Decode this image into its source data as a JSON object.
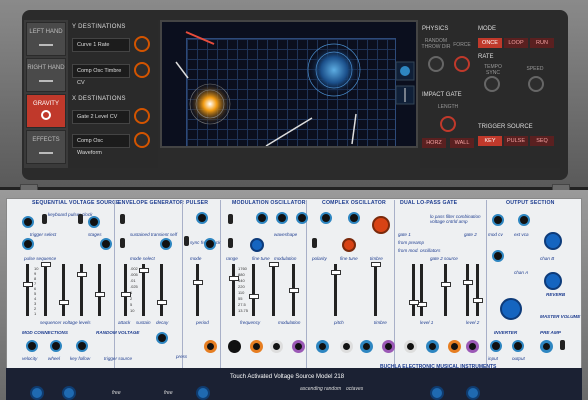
{
  "top": {
    "modes": [
      {
        "label": "LEFT HAND",
        "icon": "hand-icon"
      },
      {
        "label": "RIGHT HAND",
        "icon": "hand-icon"
      },
      {
        "label": "GRAVITY",
        "icon": "planet-icon",
        "active": true
      },
      {
        "label": "EFFECTS",
        "icon": "wave-icon"
      }
    ],
    "y_dest_title": "Y DESTINATIONS",
    "y_dest": [
      "Curve 1 Rate",
      "Comp Osc Timbre CV"
    ],
    "x_dest_title": "X DESTINATIONS",
    "x_dest": [
      "Gate 2 Level CV",
      "Comp Osc Waveform"
    ],
    "physics_title": "PHYSICS",
    "physics_random": "RANDOM THROW DIR",
    "physics_force": "FORCE",
    "impact_gate_title": "IMPACT GATE",
    "impact_length": "LENGTH",
    "impact_buttons": [
      "HORZ",
      "WALL"
    ],
    "mode_title": "MODE",
    "mode_buttons": [
      "ONCE",
      "LOOP",
      "RUN"
    ],
    "rate_title": "RATE",
    "rate_sync": "TEMPO SYNC",
    "rate_speed": "SPEED",
    "trigger_title": "TRIGGER SOURCE",
    "trigger_buttons": [
      "KEY",
      "PULSE",
      "SEQ"
    ]
  },
  "synth": {
    "sections": [
      {
        "title": "SEQUENTIAL VOLTAGE SOURCE",
        "key": "svs"
      },
      {
        "title": "ENVELOPE GENERATOR",
        "key": "env"
      },
      {
        "title": "PULSER",
        "key": "pulser"
      },
      {
        "title": "MODULATION OSCILLATOR",
        "key": "mod"
      },
      {
        "title": "COMPLEX OSCILLATOR",
        "key": "comp"
      },
      {
        "title": "DUAL LO-PASS GATE",
        "key": "lpg"
      },
      {
        "title": "OUTPUT SECTION",
        "key": "out"
      }
    ],
    "labels": {
      "trigger_select": "trigger select",
      "keyboard_pulser_clock": "keyboard pulser clock",
      "stages": "stages",
      "pulse_sequence": "pulse sequence",
      "mode_select": "mode select",
      "sustained_transient_self": "sustained transient self",
      "sync_free_clock": "sync free clock",
      "range": "range",
      "fine_tune": "fine tune",
      "polarity": "polarity",
      "timbre": "timbre",
      "waveshape": "waveshape",
      "modulation": "modulation",
      "pitch": "pitch",
      "gate2_source": "gate 2 source",
      "gate1_source": "gate 1 source",
      "level1": "level 1",
      "level2": "level 2",
      "sequencer_voltage_levels": "sequencer voltage levels",
      "attack": "attack",
      "sustain": "sustain",
      "decay": "decay",
      "period": "period",
      "frequency": "frequency",
      "mod_conn": "MOD CONNECTIONS",
      "random_voltage": "RANDOM VOLTAGE",
      "velocity": "velocity",
      "wheel": "wheel",
      "key_follow": "key follow",
      "trigger_source": "trigger source",
      "press": "press",
      "inverter": "INVERTER",
      "pre_amp": "PRE AMP",
      "input": "input",
      "output": "output",
      "reverb": "REVERB",
      "master_volume": "MASTER VOLUME",
      "chan_b": "chan B",
      "mod_cv": "mod cv",
      "ext_vca": "ext vca",
      "chan_a": "chan A",
      "ext": "ext",
      "from_preamp": "from preamp",
      "from_mod_osc": "from mod. oscillators",
      "lp_filter_combo": "lo pass filter combination voltage cntrld amp",
      "gate1": "gate 1",
      "gate2": "gate 2",
      "mode": "mode"
    },
    "fader_numbers": [
      "10",
      "9",
      "8",
      "7",
      "6",
      "5",
      "4",
      "3",
      "2",
      "1"
    ],
    "env_numbers": [
      ".002",
      ".005",
      ".01",
      ".025",
      "1",
      "2",
      "5",
      "10"
    ],
    "freq_numbers": [
      "1760",
      "880",
      "440",
      "220",
      "110",
      "55",
      "27.5",
      "13.75"
    ]
  },
  "footer": {
    "title": "Touch Activated Voltage Source Model 218",
    "brand": "BUCHLA ELECTRONIC MUSICAL INSTRUMENTS",
    "labels": [
      "free",
      "free",
      "ascending random",
      "octaves"
    ]
  }
}
